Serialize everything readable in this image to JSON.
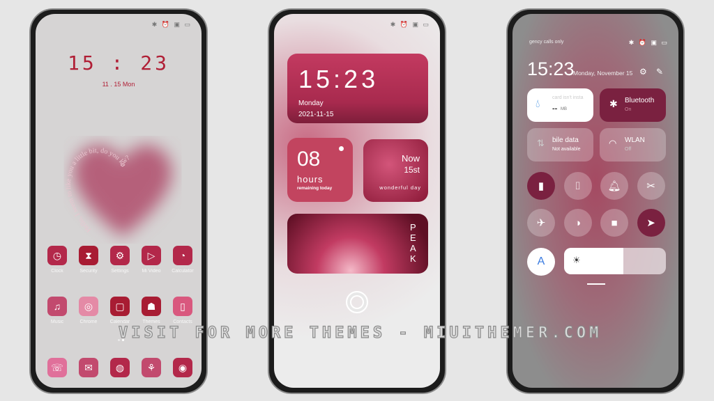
{
  "home": {
    "status_icons": "✱ ⏰ ▣ ▭",
    "time": "15 : 23",
    "date": "11 . 15 Mon",
    "heart_text": "Hello, I seem to like you a little bit, do you know?",
    "apps": [
      {
        "label": "Clock",
        "icon": "clock-icon",
        "g": "◷",
        "c": "#b3284a"
      },
      {
        "label": "Security",
        "icon": "hourglass-icon",
        "g": "⧗",
        "c": "#a81c33"
      },
      {
        "label": "Settings",
        "icon": "gear-icon",
        "g": "⚙",
        "c": "#b3284a"
      },
      {
        "label": "Mi Video",
        "icon": "play-icon",
        "g": "▷",
        "c": "#b3284a"
      },
      {
        "label": "Calculator",
        "icon": "calculator-icon",
        "g": "◔",
        "c": "#b3284a"
      },
      {
        "label": "Music",
        "icon": "music-icon",
        "g": "♫",
        "c": "#c24a6e"
      },
      {
        "label": "Chrome",
        "icon": "chrome-icon",
        "g": "◎",
        "c": "#e48aa6"
      },
      {
        "label": "Calendar",
        "icon": "calendar-icon",
        "g": "▢",
        "c": "#a81c33"
      },
      {
        "label": "Themes",
        "icon": "ghost-icon",
        "g": "☗",
        "c": "#a81c33"
      },
      {
        "label": "Contacts",
        "icon": "contacts-icon",
        "g": "▯",
        "c": "#d9587e"
      }
    ],
    "dock": [
      {
        "icon": "phone-icon",
        "g": "☏",
        "c": "#e0709a"
      },
      {
        "icon": "message-icon",
        "g": "✉",
        "c": "#c24a6e"
      },
      {
        "icon": "browser-icon",
        "g": "◍",
        "c": "#b3284a"
      },
      {
        "icon": "rose-icon",
        "g": "⚘",
        "c": "#c24a6e"
      },
      {
        "icon": "camera-icon",
        "g": "◉",
        "c": "#b3284a"
      }
    ]
  },
  "lock": {
    "status_icons": "✱ ⏰ ▣ ▭",
    "time": "15:23",
    "day": "Monday",
    "date": "2021-11-15",
    "hours": "08",
    "hours_label": "hours",
    "remaining": "remaining today",
    "now": "Now",
    "nth": "15st",
    "wonderful": "wonderful day",
    "peak": "PEAK",
    "fingerprint_icon": "fingerprint-icon"
  },
  "cc": {
    "carrier": "gency calls only",
    "status_icons": "✱ ⏰ ▣ ▭",
    "time": "15:23",
    "date": "Monday, November 15",
    "data_tile": {
      "title": "card isn't insta",
      "value": "--",
      "unit": "MB"
    },
    "bluetooth": {
      "title": "Bluetooth",
      "status": "On"
    },
    "mobile": {
      "title": "bile data",
      "status": "Not available"
    },
    "wlan": {
      "title": "WLAN",
      "status": "Off"
    },
    "toggles": [
      {
        "icon": "vibrate-icon",
        "g": "▮",
        "on": true
      },
      {
        "icon": "flashlight-icon",
        "g": "⌷",
        "on": false
      },
      {
        "icon": "bell-icon",
        "g": "🔔︎",
        "on": false
      },
      {
        "icon": "screenshot-icon",
        "g": "✂",
        "on": false
      },
      {
        "icon": "airplane-icon",
        "g": "✈",
        "on": false
      },
      {
        "icon": "reading-mode-icon",
        "g": "◑",
        "on": false
      },
      {
        "icon": "lock-icon",
        "g": "■",
        "on": false
      },
      {
        "icon": "location-icon",
        "g": "➤",
        "on": true
      }
    ],
    "auto_label": "A",
    "brightness_percent": 58
  },
  "watermark": "VISIT FOR MORE THEMES - MIUITHEMER.COM",
  "colors": {
    "accent": "#b3284a",
    "dark": "#7a2140"
  }
}
